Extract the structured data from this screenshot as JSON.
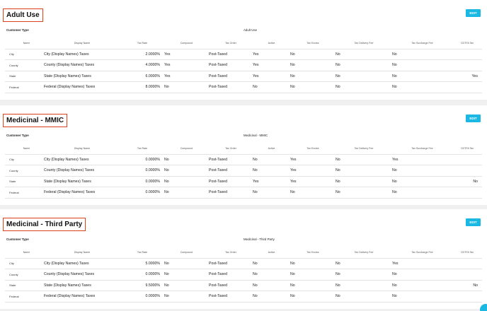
{
  "edit_label": "EDIT",
  "customer_type_label": "Customer Type",
  "columns": [
    "Name",
    "Display Name",
    "Tax Rate",
    "Compound",
    "Tax Order",
    "Active",
    "Tax Excise",
    "Tax Delivery Fee",
    "Tax Surcharge Fee",
    "CDTFA Tax"
  ],
  "sections": [
    {
      "title": "Adult Use",
      "customer_type": "Adult Use",
      "rows": [
        [
          "City",
          "City (Display Names) Taxes",
          "2.0000%",
          "Yes",
          "Post-Taxed",
          "Yes",
          "No",
          "No",
          "No",
          ""
        ],
        [
          "County",
          "County (Display Names) Taxes",
          "4.0000%",
          "Yes",
          "Post-Taxed",
          "Yes",
          "No",
          "No",
          "No",
          ""
        ],
        [
          "State",
          "State (Display Names) Taxes",
          "6.0000%",
          "Yes",
          "Post-Taxed",
          "Yes",
          "No",
          "No",
          "No",
          "Yes"
        ],
        [
          "Federal",
          "Federal (Display Names) Taxes",
          "8.0000%",
          "No",
          "Post-Taxed",
          "No",
          "No",
          "No",
          "No",
          ""
        ]
      ]
    },
    {
      "title": "Medicinal - MMIC",
      "customer_type": "Medicinal - MMIC",
      "rows": [
        [
          "City",
          "City (Display Names) Taxes",
          "0.0000%",
          "No",
          "Post-Taxed",
          "No",
          "Yes",
          "No",
          "Yes",
          ""
        ],
        [
          "County",
          "County (Display Names) Taxes",
          "0.0000%",
          "No",
          "Post-Taxed",
          "No",
          "Yes",
          "No",
          "No",
          ""
        ],
        [
          "State",
          "State (Display Names) Taxes",
          "0.0000%",
          "No",
          "Post-Taxed",
          "Yes",
          "Yes",
          "No",
          "No",
          "No"
        ],
        [
          "Federal",
          "Federal (Display Names) Taxes",
          "0.0000%",
          "No",
          "Post-Taxed",
          "No",
          "No",
          "No",
          "No",
          ""
        ]
      ]
    },
    {
      "title": "Medicinal - Third Party",
      "customer_type": "Medicinal - Third Party",
      "rows": [
        [
          "City",
          "City (Display Names) Taxes",
          "5.0000%",
          "No",
          "Post-Taxed",
          "No",
          "No",
          "No",
          "Yes",
          ""
        ],
        [
          "County",
          "County (Display Names) Taxes",
          "0.0000%",
          "No",
          "Post-Taxed",
          "No",
          "No",
          "No",
          "No",
          ""
        ],
        [
          "State",
          "State (Display Names) Taxes",
          "9.5000%",
          "No",
          "Post-Taxed",
          "No",
          "No",
          "No",
          "No",
          "No"
        ],
        [
          "Federal",
          "Federal (Display Names) Taxes",
          "0.0000%",
          "No",
          "Post-Taxed",
          "No",
          "No",
          "No",
          "No",
          ""
        ]
      ]
    }
  ]
}
